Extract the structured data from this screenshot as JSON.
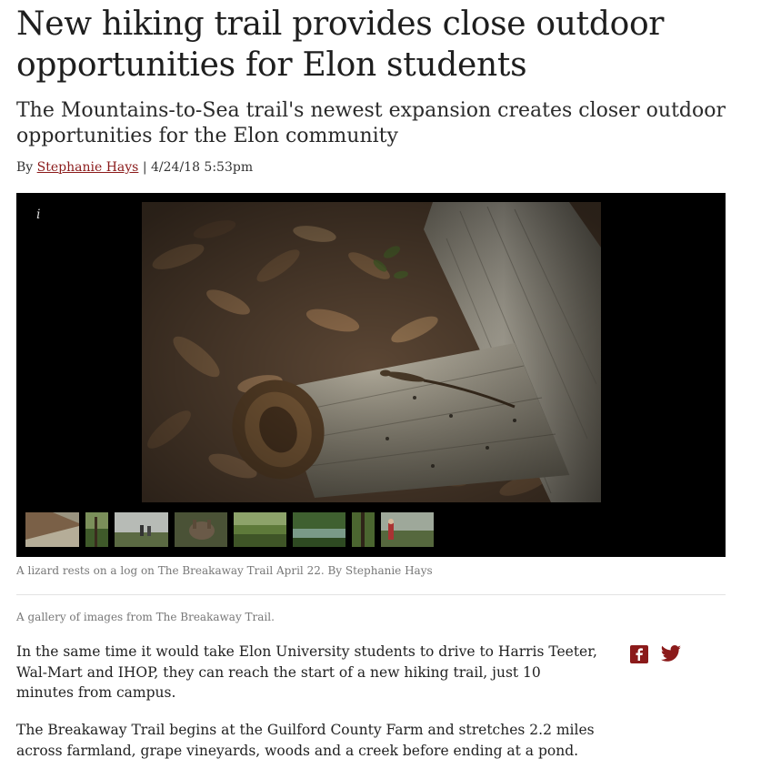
{
  "article": {
    "headline": "New hiking trail provides close outdoor opportunities for Elon students",
    "subheadline": "The Mountains-to-Sea trail's newest expansion creates closer outdoor opportunities for the Elon community",
    "byline_prefix": "By",
    "author": "Stephanie Hays",
    "separator": "|",
    "datetime": "4/24/18 5:53pm"
  },
  "gallery": {
    "info_label": "i",
    "caption": "A lizard rests on a log on The Breakaway Trail April 22. By Stephanie Hays",
    "note": "A gallery of images from The Breakaway Trail.",
    "thumbnails": [
      "thumb-1",
      "thumb-2",
      "thumb-3",
      "thumb-4",
      "thumb-5",
      "thumb-6",
      "thumb-7",
      "thumb-8"
    ]
  },
  "body": {
    "paragraph_1": "In the same time it would take Elon University students to drive to Harris Teeter, Wal-Mart and IHOP, they can reach the start of a new hiking trail, just 10 minutes from campus.",
    "paragraph_2": "The Breakaway Trail begins at the Guilford County Farm and stretches 2.2 miles across farmland, grape vineyards, woods and a creek before ending at a pond."
  },
  "share": {
    "icons": [
      "facebook-icon",
      "twitter-icon"
    ],
    "color": "#8b1a1a"
  },
  "colors": {
    "link": "#8b1a1a",
    "gallery_background": "#000000"
  }
}
